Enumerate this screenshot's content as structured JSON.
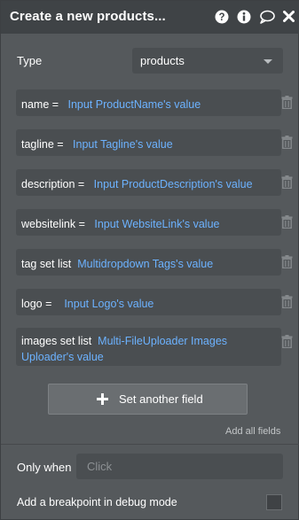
{
  "header": {
    "title": "Create a new products...",
    "icons": [
      "help-icon",
      "info-icon",
      "comment-icon",
      "close-icon"
    ]
  },
  "type_row": {
    "label": "Type",
    "value": "products"
  },
  "fields": [
    {
      "key": "name =",
      "value": "Input ProductName's value"
    },
    {
      "key": "tagline =",
      "value": "Input Tagline's value"
    },
    {
      "key": "description =",
      "value": "Input ProductDescription's value"
    },
    {
      "key": "websitelink =",
      "value": "Input WebsiteLink's value"
    },
    {
      "key": "tag set list",
      "value": "Multidropdown Tags's value"
    },
    {
      "key": "logo =",
      "value": "Input Logo's value"
    },
    {
      "key": "images set list",
      "value": "Multi-FileUploader Images Uploader's value"
    }
  ],
  "set_another_label": "Set another field",
  "add_all_label": "Add all fields",
  "only_when": {
    "label": "Only when",
    "placeholder": "Click"
  },
  "breakpoint": {
    "label": "Add a breakpoint in debug mode",
    "checked": false
  },
  "colors": {
    "panel": "#55595c",
    "header": "#3f4346",
    "field": "#4a4e51",
    "value_text": "#6cb2ff"
  }
}
